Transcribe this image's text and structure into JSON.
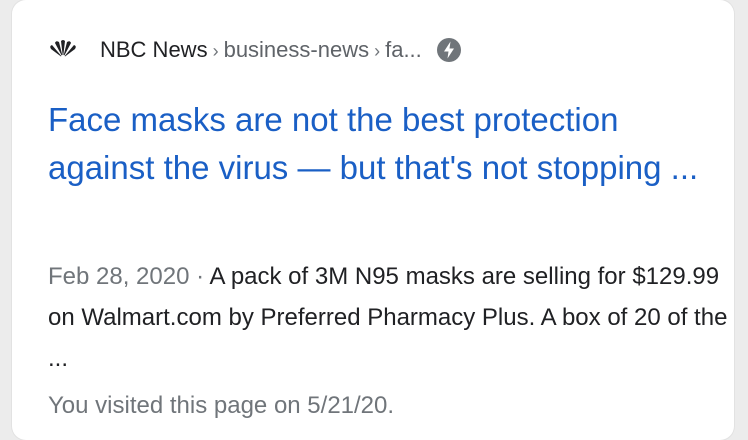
{
  "result": {
    "source": {
      "logo_icon": "nbc-peacock-icon",
      "site_name": "NBC News",
      "separator": "›",
      "breadcrumbs": [
        "business-news",
        "fa..."
      ],
      "amp_icon": "amp-lightning-icon"
    },
    "title": "Face masks are not the best protection against the virus — but that's not stopping ...",
    "date": "Feb 28, 2020",
    "date_separator": " · ",
    "snippet": "A pack of 3M N95 masks are selling for $129.99 on Walmart.com by Preferred Pharmacy Plus. A box of 20 of the ...",
    "visited_note": "You visited this page on 5/21/20."
  },
  "colors": {
    "title_link": "#1a5fc5",
    "body_text": "#202124",
    "muted_text": "#70757a"
  }
}
